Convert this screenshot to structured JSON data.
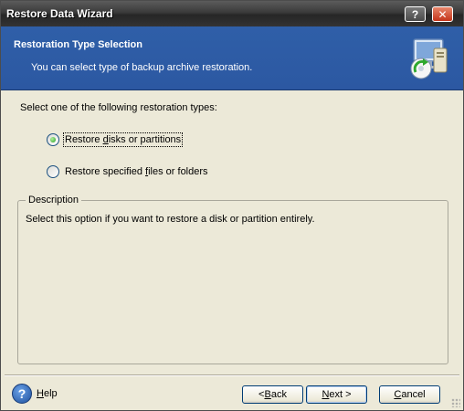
{
  "window": {
    "title": "Restore Data Wizard"
  },
  "titlebar": {
    "help_glyph": "?",
    "close_glyph": "✕"
  },
  "header": {
    "title": "Restoration Type Selection",
    "subtitle": "You can select type of backup archive restoration.",
    "icon": "restore-wizard-icon"
  },
  "content": {
    "prompt": "Select one of the following restoration types:",
    "options": [
      {
        "label_pre": "Restore ",
        "label_ul": "d",
        "label_post": "isks or partitions",
        "selected": true
      },
      {
        "label_pre": "Restore specified ",
        "label_ul": "f",
        "label_post": "iles or folders",
        "selected": false
      }
    ]
  },
  "description": {
    "legend": "Description",
    "text": "Select this option if you want to restore a disk or partition entirely."
  },
  "footer": {
    "help": {
      "ul": "H",
      "rest": "elp",
      "icon": "help-icon"
    },
    "back": {
      "pre": "< ",
      "ul": "B",
      "rest": "ack"
    },
    "next": {
      "ul": "N",
      "rest": "ext >"
    },
    "cancel": {
      "ul": "C",
      "rest": "ancel"
    }
  },
  "colors": {
    "header_bg": "#2f5fa8",
    "titlebar_bg": "#333333",
    "dialog_bg": "#ece9d8",
    "radio_selected": "#21a121"
  }
}
